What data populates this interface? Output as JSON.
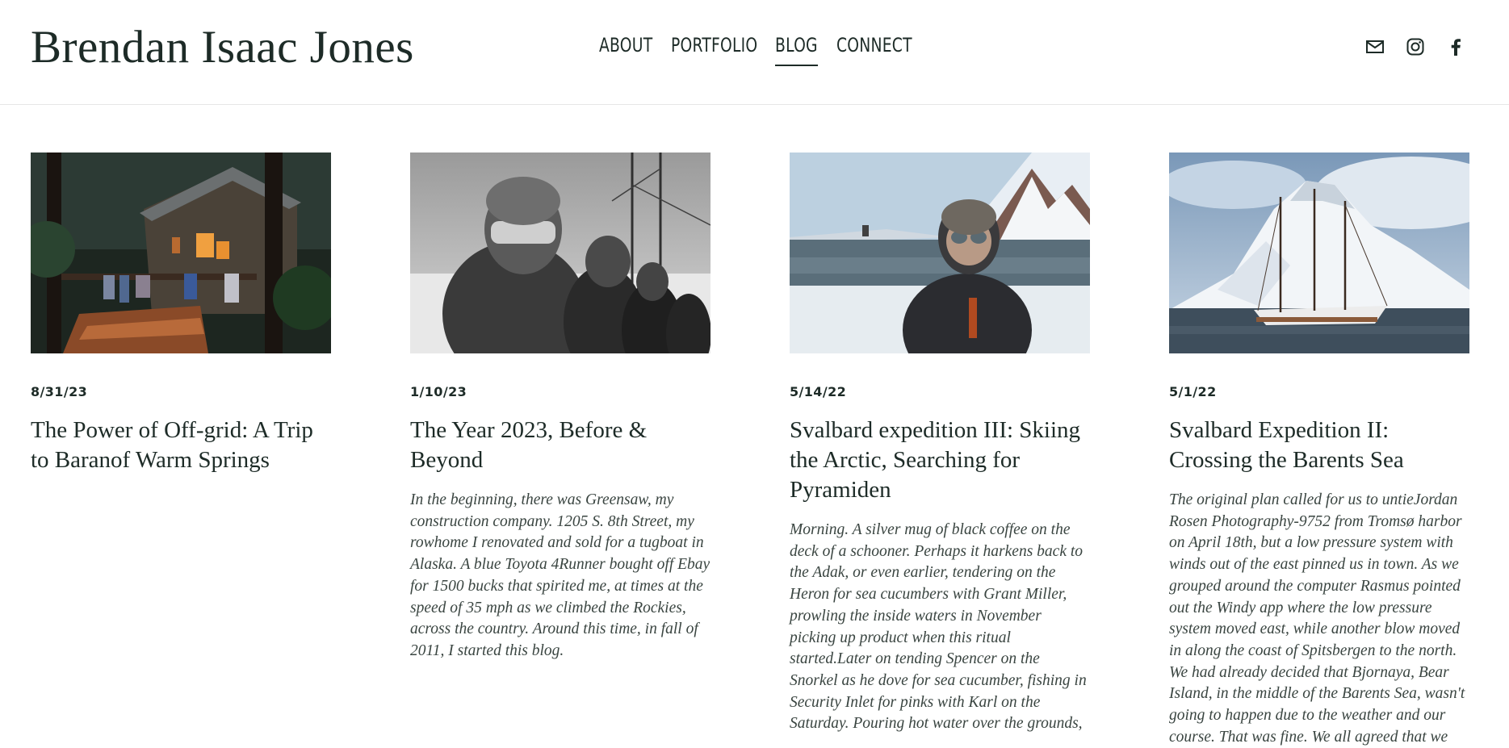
{
  "site": {
    "title": "Brendan Isaac Jones"
  },
  "nav": {
    "items": [
      {
        "label": "ABOUT"
      },
      {
        "label": "PORTFOLIO"
      },
      {
        "label": "BLOG"
      },
      {
        "label": "CONNECT"
      }
    ],
    "active": "BLOG"
  },
  "social": [
    "mail-icon",
    "instagram-icon",
    "facebook-icon"
  ],
  "posts": [
    {
      "date": "8/31/23",
      "title": "The Power of Off-grid: A Trip to Baranof Warm Springs",
      "excerpt": ""
    },
    {
      "date": "1/10/23",
      "title": "The Year 2023, Before & Beyond",
      "excerpt": "In the beginning, there was Greensaw, my construction company. 1205 S. 8th Street, my rowhome I renovated and sold for a tugboat in Alaska. A blue Toyota 4Runner bought off Ebay for 1500 bucks that spirited me, at times at the speed of 35 mph as we climbed the Rockies, across the country. Around this time, in fall of 2011, I started this blog."
    },
    {
      "date": "5/14/22",
      "title": "Svalbard expedition III: Skiing the Arctic, Searching for Pyramiden",
      "excerpt": "Morning. A silver mug of black coffee on the deck of a schooner.  Perhaps it harkens back to the Adak, or even earlier, tendering on the Heron for sea cucumbers with Grant Miller, prowling the inside waters in November picking up product when this ritual started.Later on tending Spencer on the Snorkel as he dove for sea cucumber, fishing in Security Inlet for pinks with Karl on the Saturday. Pouring hot water over the grounds,"
    },
    {
      "date": "5/1/22",
      "title": "Svalbard Expedition II: Crossing the Barents Sea",
      "excerpt": "The original plan called for us to untieJordan Rosen Photography-9752 from Tromsø harbor on April 18th, but a low pressure system with winds out of the east pinned us in town. As we grouped around the computer Rasmus pointed out the Windy app where the low pressure system moved east, while another blow moved in along the coast of Spitsbergen to the north. We had already decided that Bjornaya, Bear Island, in the middle of the Barents Sea, wasn't going to happen due to the weather and our course. That was fine. We all agreed that we"
    }
  ]
}
